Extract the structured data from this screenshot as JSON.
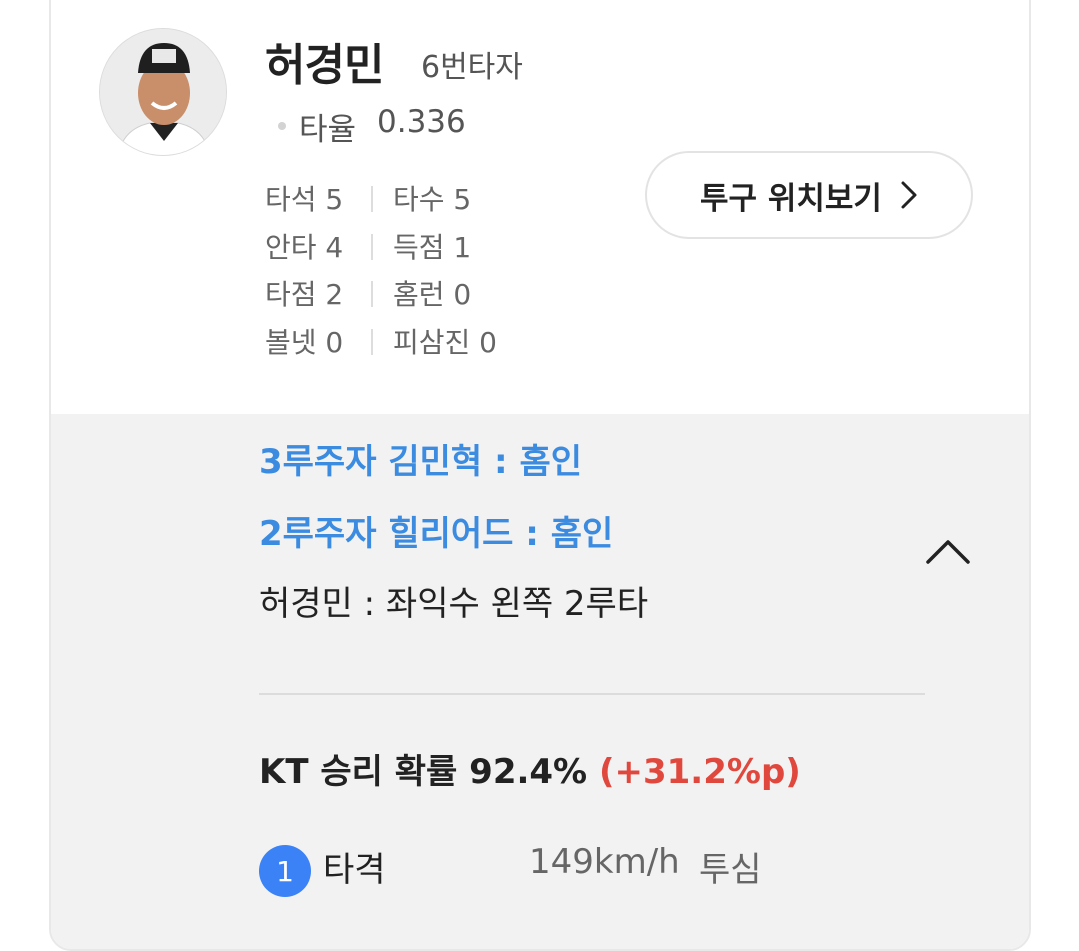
{
  "player": {
    "name": "허경민",
    "batting_order": "6번타자",
    "avg_label": "타율",
    "avg_value": "0.336"
  },
  "stats": [
    {
      "left": "타석 5",
      "right": "타수 5"
    },
    {
      "left": "안타 4",
      "right": "득점 1"
    },
    {
      "left": "타점 2",
      "right": "홈런 0"
    },
    {
      "left": "볼넷 0",
      "right": "피삼진 0"
    }
  ],
  "pitch_location_button": {
    "label": "투구 위치보기"
  },
  "events": [
    {
      "text": "3루주자 김민혁 : 홈인"
    },
    {
      "text": "2루주자 힐리어드 : 홈인"
    },
    {
      "text": "허경민 : 좌익수 왼쪽 2루타"
    }
  ],
  "win_probability": {
    "text": "KT 승리 확률 92.4%",
    "change": "(+31.2%p)"
  },
  "pitch": {
    "number": "1",
    "result": "타격",
    "speed": "149km/h",
    "type": "투심"
  },
  "colors": {
    "accent_blue": "#3b8be0",
    "badge_blue": "#3b82f6",
    "positive_red": "#e0483e"
  },
  "icons": {
    "avatar": "player-photo",
    "button_chevron": "chevron-right-icon",
    "collapse": "chevron-up-icon"
  }
}
